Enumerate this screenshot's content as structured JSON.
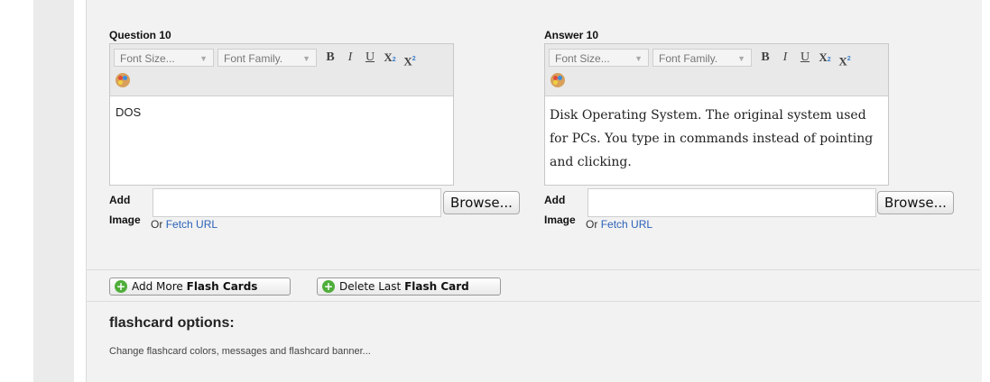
{
  "question": {
    "label": "Question 10",
    "text": "DOS"
  },
  "answer": {
    "label": "Answer 10",
    "text": "Disk Operating System. The original system used for PCs. You type in commands instead of pointing and clicking."
  },
  "toolbar": {
    "font_size": "Font Size...",
    "font_family": "Font Family.",
    "bold": "B",
    "italic": "I",
    "underline": "U",
    "subscript": "X",
    "superscript": "X",
    "sub_mark": "2",
    "sup_mark": "2",
    "caret": "▼"
  },
  "image": {
    "add": "Add",
    "image": "Image",
    "or": "Or",
    "fetch_url": "Fetch URL",
    "browse": "Browse..."
  },
  "buttons": {
    "add_more_prefix": "Add More",
    "add_more_strong": "Flash Cards",
    "delete_prefix": "Delete Last",
    "delete_strong": "Flash Card",
    "plus": "+"
  },
  "options": {
    "title": "flashcard options:",
    "subtitle": "Change flashcard colors, messages and flashcard banner..."
  }
}
